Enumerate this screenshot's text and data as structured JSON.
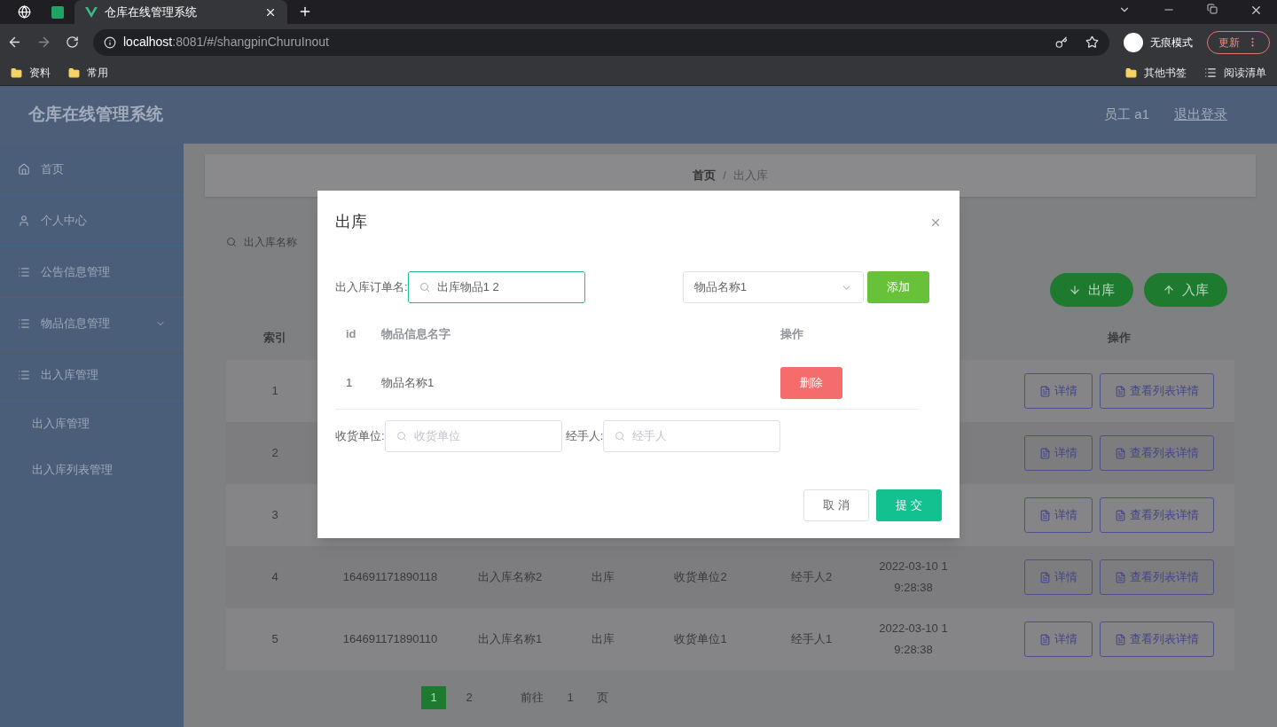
{
  "browser": {
    "tabs": [
      {
        "kind": "icon",
        "selected": false
      },
      {
        "kind": "icon",
        "selected": false
      },
      {
        "kind": "page",
        "title": "仓库在线管理系统",
        "selected": true
      }
    ],
    "address": {
      "host": "localhost",
      "path": ":8081/#/shangpinChuruInout"
    },
    "profile": "无痕模式",
    "update": "更新",
    "bookmarks": [
      "资料",
      "常用"
    ],
    "bookmarks_right": [
      "其他书签",
      "阅读清单"
    ]
  },
  "app": {
    "title": "仓库在线管理系统",
    "user": "员工 a1",
    "logout": "退出登录"
  },
  "sidebar": [
    {
      "label": "首页"
    },
    {
      "label": "个人中心"
    },
    {
      "label": "公告信息管理"
    },
    {
      "label": "物品信息管理",
      "expandable": true
    },
    {
      "label": "出入库管理",
      "expandable": false,
      "children": [
        {
          "label": "出入库管理"
        },
        {
          "label": "出入库列表管理"
        }
      ]
    }
  ],
  "breadcrumb": {
    "items": [
      "首页",
      "出入库"
    ],
    "separator": "/"
  },
  "search": {
    "placeholder": "出入库名称"
  },
  "actions": [
    {
      "label": "出库",
      "kind": "out"
    },
    {
      "label": "入库",
      "kind": "in"
    }
  ],
  "table": {
    "columns": [
      "索引",
      "操作"
    ],
    "rows": [
      {
        "cells": [
          "1",
          "",
          "",
          "",
          "",
          "",
          ""
        ],
        "buttons": [
          "详情",
          "查看列表详情"
        ]
      },
      {
        "cells": [
          "2",
          "",
          "",
          "",
          "",
          "",
          ""
        ],
        "buttons": [
          "详情",
          "查看列表详情"
        ]
      },
      {
        "cells": [
          "3",
          "",
          "",
          "",
          "",
          "",
          ""
        ],
        "buttons": [
          "详情",
          "查看列表详情"
        ]
      },
      {
        "cells": [
          "4",
          "164691171890118",
          "出入库名称2",
          "出库",
          "收货单位2",
          "经手人2",
          "2022-03-10 19:28:38"
        ],
        "buttons": [
          "详情",
          "查看列表详情"
        ]
      },
      {
        "cells": [
          "5",
          "164691171890110",
          "出入库名称1",
          "出库",
          "收货单位1",
          "经手人1",
          "2022-03-10 19:28:38"
        ],
        "buttons": [
          "详情",
          "查看列表详情"
        ]
      }
    ]
  },
  "pagination": {
    "pages": [
      {
        "label": "1",
        "selected": true
      },
      {
        "label": "2",
        "selected": false
      }
    ],
    "goto": "前往",
    "page": "1",
    "unit": "页"
  },
  "dialog": {
    "title": "出库",
    "order_label": "出入库订单名:",
    "order_value": "出库物品1 2",
    "item_value": "物品名称1",
    "add": "添加",
    "columns": [
      "id",
      "物品信息名字",
      "操作"
    ],
    "rows": [
      {
        "id": "1",
        "name": "物品名称1",
        "delete": "删除"
      }
    ],
    "receiver_label": "收货单位:",
    "receiver_placeholder": "收货单位",
    "handler_label": "经手人:",
    "handler_placeholder": "经手人",
    "cancel": "取 消",
    "submit": "提 交"
  }
}
